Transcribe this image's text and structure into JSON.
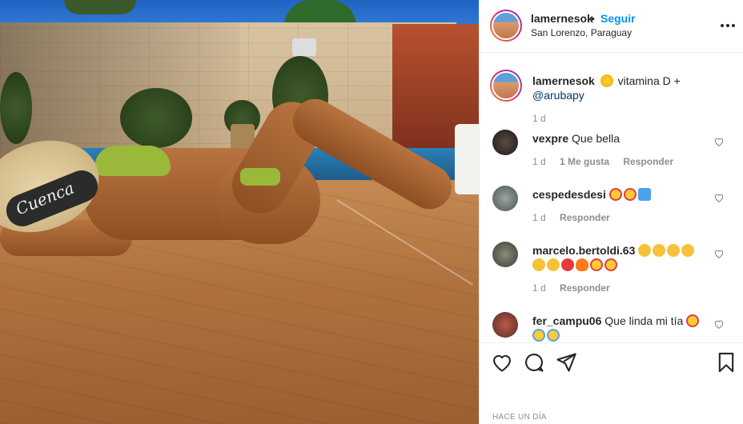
{
  "header": {
    "username": "lamernesok",
    "separator": "•",
    "follow_label": "Seguir",
    "location": "San Lorenzo, Paraguay",
    "more_icon": "more-options-icon"
  },
  "photo": {
    "hat_text": "Cuenca"
  },
  "caption": {
    "username": "lamernesok",
    "emoji": "sun-emoji",
    "text": " vitamina D +",
    "mention": "@arubapy",
    "age": "1 d"
  },
  "comments": [
    {
      "username": "vexpre",
      "text": "Que bella",
      "age": "1 d",
      "likes": "1 Me gusta",
      "reply": "Responder"
    },
    {
      "username": "cespedesdesi",
      "text": "",
      "emojis": [
        "heart-eyes-emoji",
        "heart-eyes-emoji",
        "raised-hands-emoji"
      ],
      "age": "1 d",
      "reply": "Responder"
    },
    {
      "username": "marcelo.bertoldi.63",
      "text": "",
      "emojis": [
        "clap-emoji",
        "clap-emoji",
        "clap-emoji",
        "clap-emoji",
        "clap-emoji",
        "clap-emoji",
        "heart-emoji",
        "fire-emoji",
        "heart-eyes-emoji",
        "heart-eyes-emoji"
      ],
      "age": "1 d",
      "reply": "Responder"
    },
    {
      "username": "fer_campu06",
      "text": "Que linda mi tía",
      "emojis": [
        "heart-eyes-emoji",
        "grimace-emoji",
        "grimace-emoji"
      ],
      "age": "",
      "reply": ""
    }
  ],
  "actions": {
    "like_icon": "heart-icon",
    "comment_icon": "comment-icon",
    "share_icon": "share-icon",
    "save_icon": "bookmark-icon"
  },
  "footer": {
    "timestamp": "HACE UN DÍA"
  },
  "colors": {
    "link": "#0095f6",
    "text": "#262626",
    "muted": "#8e8e8e",
    "border": "#efefef"
  }
}
